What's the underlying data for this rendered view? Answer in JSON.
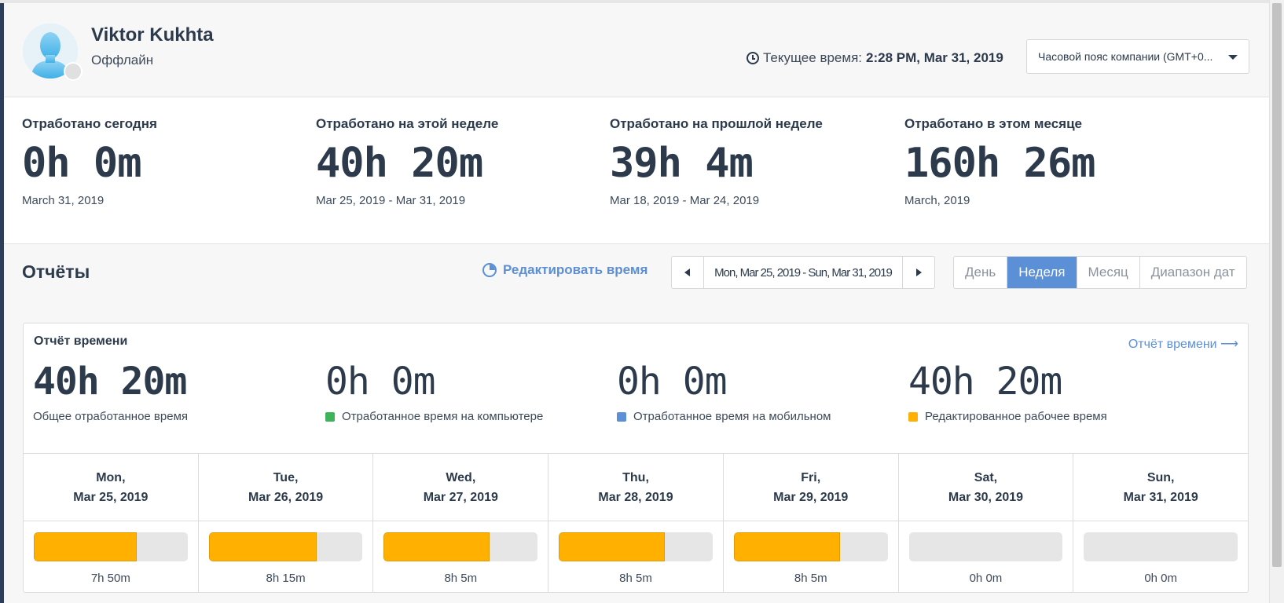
{
  "user": {
    "name": "Viktor Kukhta",
    "status": "Оффлайн"
  },
  "current_time": {
    "label": "Текущее время:",
    "value": "2:28 PM, Mar 31, 2019"
  },
  "timezone_select": {
    "value": "Часовой пояс компании (GMT+0..."
  },
  "stats": [
    {
      "label": "Отработано сегодня",
      "value": "0h 0m",
      "range": "March 31, 2019"
    },
    {
      "label": "Отработано на этой неделе",
      "value": "40h 20m",
      "range": "Mar 25, 2019 - Mar 31, 2019"
    },
    {
      "label": "Отработано на прошлой неделе",
      "value": "39h 4m",
      "range": "Mar 18, 2019 - Mar 24, 2019"
    },
    {
      "label": "Отработано в этом месяце",
      "value": "160h 26m",
      "range": "March, 2019"
    }
  ],
  "reports": {
    "title": "Отчёты",
    "edit_time": "Редактировать время",
    "date_range": "Mon, Mar 25, 2019 - Sun, Mar 31, 2019",
    "periods": [
      "День",
      "Неделя",
      "Месяц",
      "Диапазон дат"
    ],
    "active_period": "Неделя"
  },
  "time_report": {
    "title": "Отчёт времени",
    "link": "Отчёт времени ⟶",
    "metrics": [
      {
        "value": "40h 20m",
        "label": "Общее отработанное время",
        "color": ""
      },
      {
        "value": "0h 0m",
        "label": "Отработанное время на компьютере",
        "color": "#3db35a"
      },
      {
        "value": "0h 0m",
        "label": "Отработанное время на мобильном",
        "color": "#5b8fd6"
      },
      {
        "value": "40h 20m",
        "label": "Редактированное рабочее время",
        "color": "#ffb000"
      }
    ],
    "days": [
      {
        "day": "Mon,",
        "date": "Mar 25, 2019",
        "total": "7h 50m",
        "fill": 0.67
      },
      {
        "day": "Tue,",
        "date": "Mar 26, 2019",
        "total": "8h 15m",
        "fill": 0.7
      },
      {
        "day": "Wed,",
        "date": "Mar 27, 2019",
        "total": "8h 5m",
        "fill": 0.69
      },
      {
        "day": "Thu,",
        "date": "Mar 28, 2019",
        "total": "8h 5m",
        "fill": 0.69
      },
      {
        "day": "Fri,",
        "date": "Mar 29, 2019",
        "total": "8h 5m",
        "fill": 0.69
      },
      {
        "day": "Sat,",
        "date": "Mar 30, 2019",
        "total": "0h 0m",
        "fill": 0
      },
      {
        "day": "Sun,",
        "date": "Mar 31, 2019",
        "total": "0h 0m",
        "fill": 0
      }
    ]
  }
}
